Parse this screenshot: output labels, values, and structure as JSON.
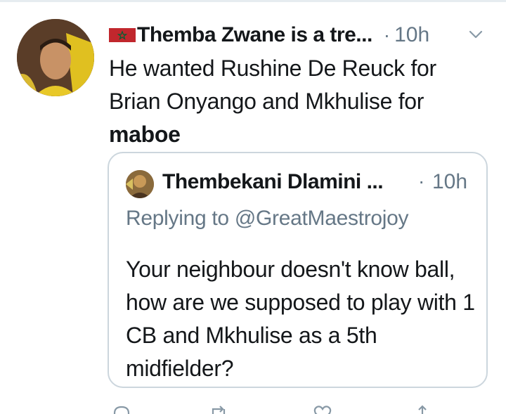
{
  "tweet": {
    "display_name": "Themba Zwane is a tre...",
    "separator": "·",
    "time": "10h",
    "text_main": "He wanted Rushine De Reuck for Brian Onyango and Mkhulise for ",
    "text_bold": "maboe",
    "flag_icon": "flag-icon",
    "menu_icon": "chevron-down-icon"
  },
  "quote": {
    "display_name": "Thembekani Dlamini ...",
    "separator": "·",
    "time": "10h",
    "replying": "Replying to @GreatMaestrojoy",
    "text": "Your neighbour doesn't know ball, how are we supposed to play with 1 CB and Mkhulise as a 5th midfielder?"
  },
  "actions": {
    "icons": [
      "reply-icon",
      "retweet-icon",
      "like-icon",
      "share-icon"
    ]
  },
  "colors": {
    "text": "#14171a",
    "secondary": "#657786",
    "border": "#ccd6dd"
  }
}
